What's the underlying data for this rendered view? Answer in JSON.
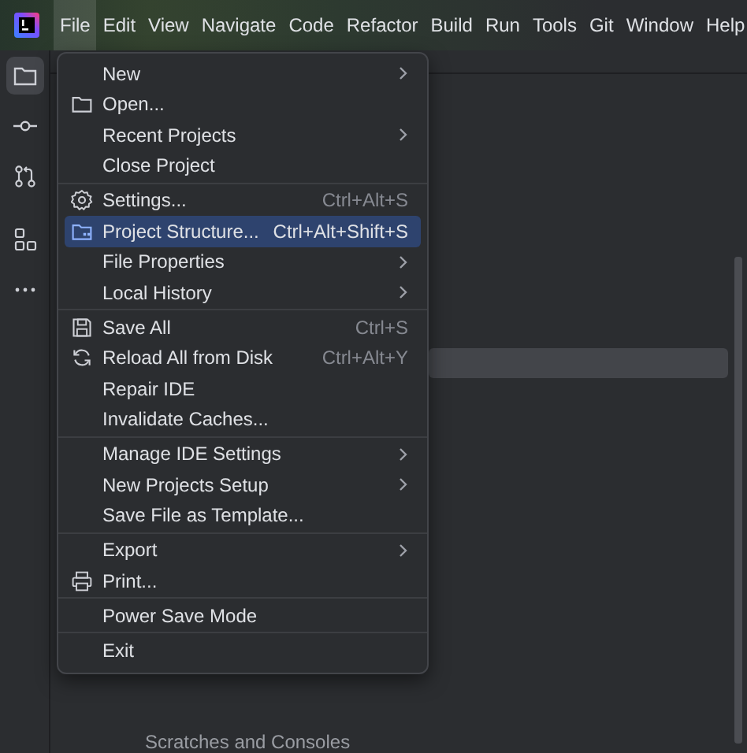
{
  "menubar": [
    {
      "label": "File",
      "selected": true
    },
    {
      "label": "Edit",
      "selected": false
    },
    {
      "label": "View",
      "selected": false
    },
    {
      "label": "Navigate",
      "selected": false
    },
    {
      "label": "Code",
      "selected": false
    },
    {
      "label": "Refactor",
      "selected": false
    },
    {
      "label": "Build",
      "selected": false
    },
    {
      "label": "Run",
      "selected": false
    },
    {
      "label": "Tools",
      "selected": false
    },
    {
      "label": "Git",
      "selected": false
    },
    {
      "label": "Window",
      "selected": false
    },
    {
      "label": "Help",
      "selected": false
    }
  ],
  "tool_strip": [
    {
      "selected": true
    },
    {
      "selected": false
    },
    {
      "selected": false
    },
    {
      "selected": false
    },
    {
      "selected": false
    }
  ],
  "project_tree": {
    "items": [
      {
        "label": "Scratches and Consoles"
      }
    ]
  },
  "file_menu": {
    "groups": [
      {
        "items": [
          {
            "label": "New",
            "submenu": true,
            "selected": false
          },
          {
            "label": "Open...",
            "submenu": false,
            "selected": false
          },
          {
            "label": "Recent Projects",
            "submenu": true,
            "selected": false
          },
          {
            "label": "Close Project",
            "submenu": false,
            "selected": false
          }
        ]
      },
      {
        "items": [
          {
            "label": "Settings...",
            "shortcut": "Ctrl+Alt+S",
            "submenu": false,
            "selected": false
          },
          {
            "label": "Project Structure...",
            "shortcut": "Ctrl+Alt+Shift+S",
            "submenu": false,
            "selected": true
          },
          {
            "label": "File Properties",
            "submenu": true,
            "selected": false
          },
          {
            "label": "Local History",
            "submenu": true,
            "selected": false
          }
        ]
      },
      {
        "items": [
          {
            "label": "Save All",
            "shortcut": "Ctrl+S",
            "submenu": false,
            "selected": false
          },
          {
            "label": "Reload All from Disk",
            "shortcut": "Ctrl+Alt+Y",
            "submenu": false,
            "selected": false
          },
          {
            "label": "Repair IDE",
            "submenu": false,
            "selected": false
          },
          {
            "label": "Invalidate Caches...",
            "submenu": false,
            "selected": false
          }
        ]
      },
      {
        "items": [
          {
            "label": "Manage IDE Settings",
            "submenu": true,
            "selected": false
          },
          {
            "label": "New Projects Setup",
            "submenu": true,
            "selected": false
          },
          {
            "label": "Save File as Template...",
            "submenu": false,
            "selected": false
          }
        ]
      },
      {
        "items": [
          {
            "label": "Export",
            "submenu": true,
            "selected": false
          },
          {
            "label": "Print...",
            "submenu": false,
            "selected": false
          }
        ]
      },
      {
        "items": [
          {
            "label": "Power Save Mode",
            "submenu": false,
            "selected": false
          }
        ]
      },
      {
        "items": [
          {
            "label": "Exit",
            "submenu": false,
            "selected": false
          }
        ]
      }
    ]
  }
}
